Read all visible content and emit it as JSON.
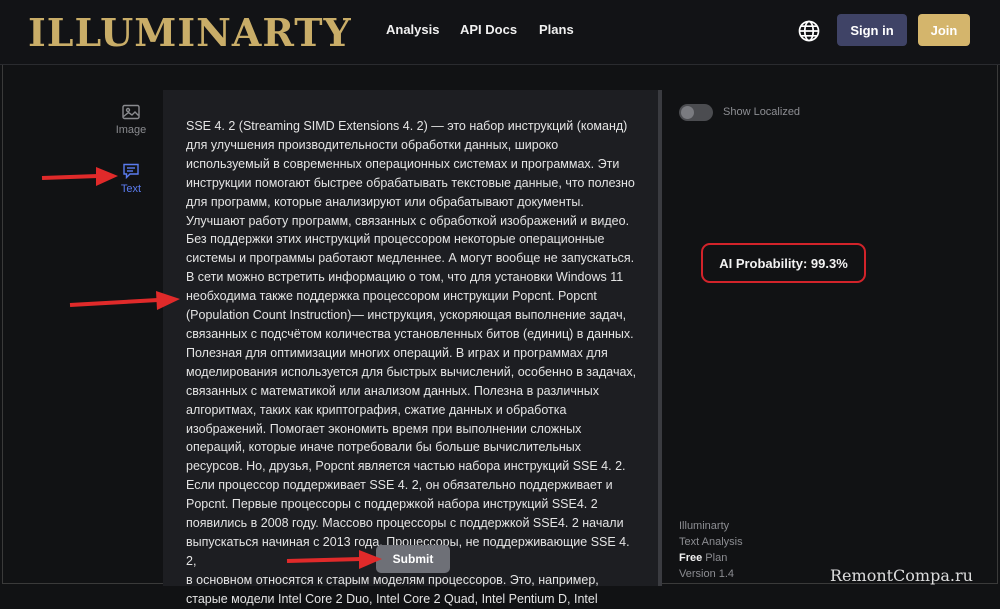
{
  "app": {
    "logo_text": "ILLUMINARTY"
  },
  "nav": {
    "analysis": "Analysis",
    "api_docs": "API Docs",
    "plans": "Plans"
  },
  "header": {
    "signin_label": "Sign in",
    "join_label": "Join",
    "globe_icon": "globe-icon"
  },
  "sidebar": {
    "items": [
      {
        "label": "Image",
        "icon": "image-icon"
      },
      {
        "label": "Text",
        "icon": "message-icon"
      }
    ]
  },
  "editor": {
    "text": "SSE 4. 2 (Streaming SIMD Extensions 4. 2) — это набор инструкций (команд)\nдля улучшения производительности обработки данных, широко\nиспользуемый в современных операционных системах и программах. Эти\nинструкции помогают быстрее обрабатывать текстовые данные, что полезно\nдля программ, которые анализируют или обрабатывают документы.\nУлучшают работу программ, связанных с обработкой изображений и видео.\nБез поддержки этих инструкций процессором некоторые операционные\nсистемы и программы работают медленнее. А могут вообще не запускаться.\nВ сети можно встретить информацию о том, что для установки Windows 11\nнеобходима также поддержка процессором инструкции Popcnt. Popcnt\n(Population Count Instruction)— инструкция, ускоряющая выполнение задач,\nсвязанных с подсчётом количества установленных битов (единиц) в данных.\nПолезная для оптимизации многих операций. В играх и программах для\nмоделирования используется для быстрых вычислений, особенно в задачах,\nсвязанных с математикой или анализом данных. Полезна в различных\nалгоритмах, таких как криптография, сжатие данных и обработка\nизображений. Помогает экономить время при выполнении сложных\nопераций, которые иначе потребовали бы больше вычислительных\nресурсов. Но, друзья, Popcnt является частью набора инструкций SSE 4. 2.\nЕсли процессор поддерживает SSE 4. 2, он обязательно поддерживает и\nPopcnt. Первые процессоры с поддержкой набора инструкций SSE4. 2\nпоявились в 2008 году. Массово процессоры с поддержкой SSE4. 2 начали\nвыпускаться начиная с 2013 года. Процессоры, не поддерживающие SSE 4. 2,\nв основном относятся к старым моделям процессоров. Это, например,\nстарые модели Intel Core 2 Duo, Intel Core 2 Quad, Intel Pentium D, Intel",
    "submit_label": "Submit"
  },
  "right_panel": {
    "toggle_label": "Show Localized",
    "toggle_on": false,
    "ai_probability": "AI Probability: 99.3%"
  },
  "info": {
    "app_name": "Illuminarty",
    "product": "Text Analysis",
    "plan_bold": "Free",
    "plan_suffix": " Plan",
    "version": "Version 1.4"
  },
  "watermark": "RemontCompa.ru",
  "colors": {
    "accent_gold": "#c9ad68",
    "signin_bg": "#3f4366",
    "join_bg": "#d4b56c",
    "highlight_red": "#d2232a",
    "active_blue": "#5b7cf0"
  }
}
